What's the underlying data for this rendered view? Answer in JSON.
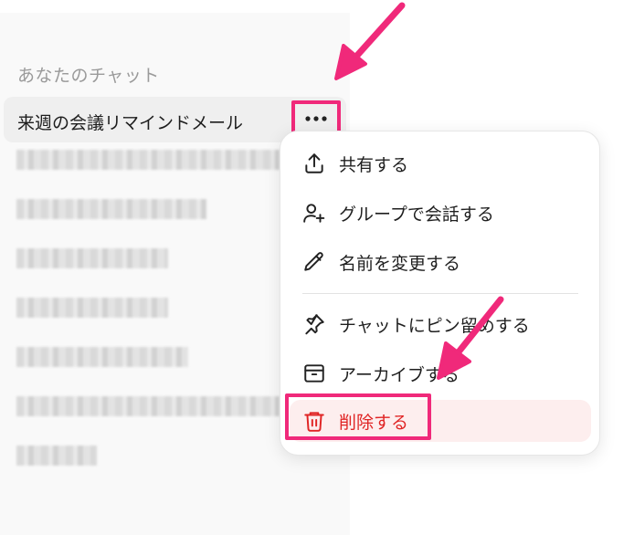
{
  "sidebar": {
    "section_label": "あなたのチャット",
    "active_chat": "来週の会議リマインドメール"
  },
  "menu": {
    "items": [
      {
        "label": "共有する",
        "icon": "share-icon"
      },
      {
        "label": "グループで会話する",
        "icon": "add-person-icon"
      },
      {
        "label": "名前を変更する",
        "icon": "pencil-icon"
      },
      {
        "label": "チャットにピン留めする",
        "icon": "pin-icon"
      },
      {
        "label": "アーカイブする",
        "icon": "archive-icon"
      },
      {
        "label": "削除する",
        "icon": "trash-icon"
      }
    ]
  },
  "colors": {
    "annotation": "#f0297a",
    "danger": "#e02424",
    "sidebar_bg": "#f9f9f9"
  }
}
